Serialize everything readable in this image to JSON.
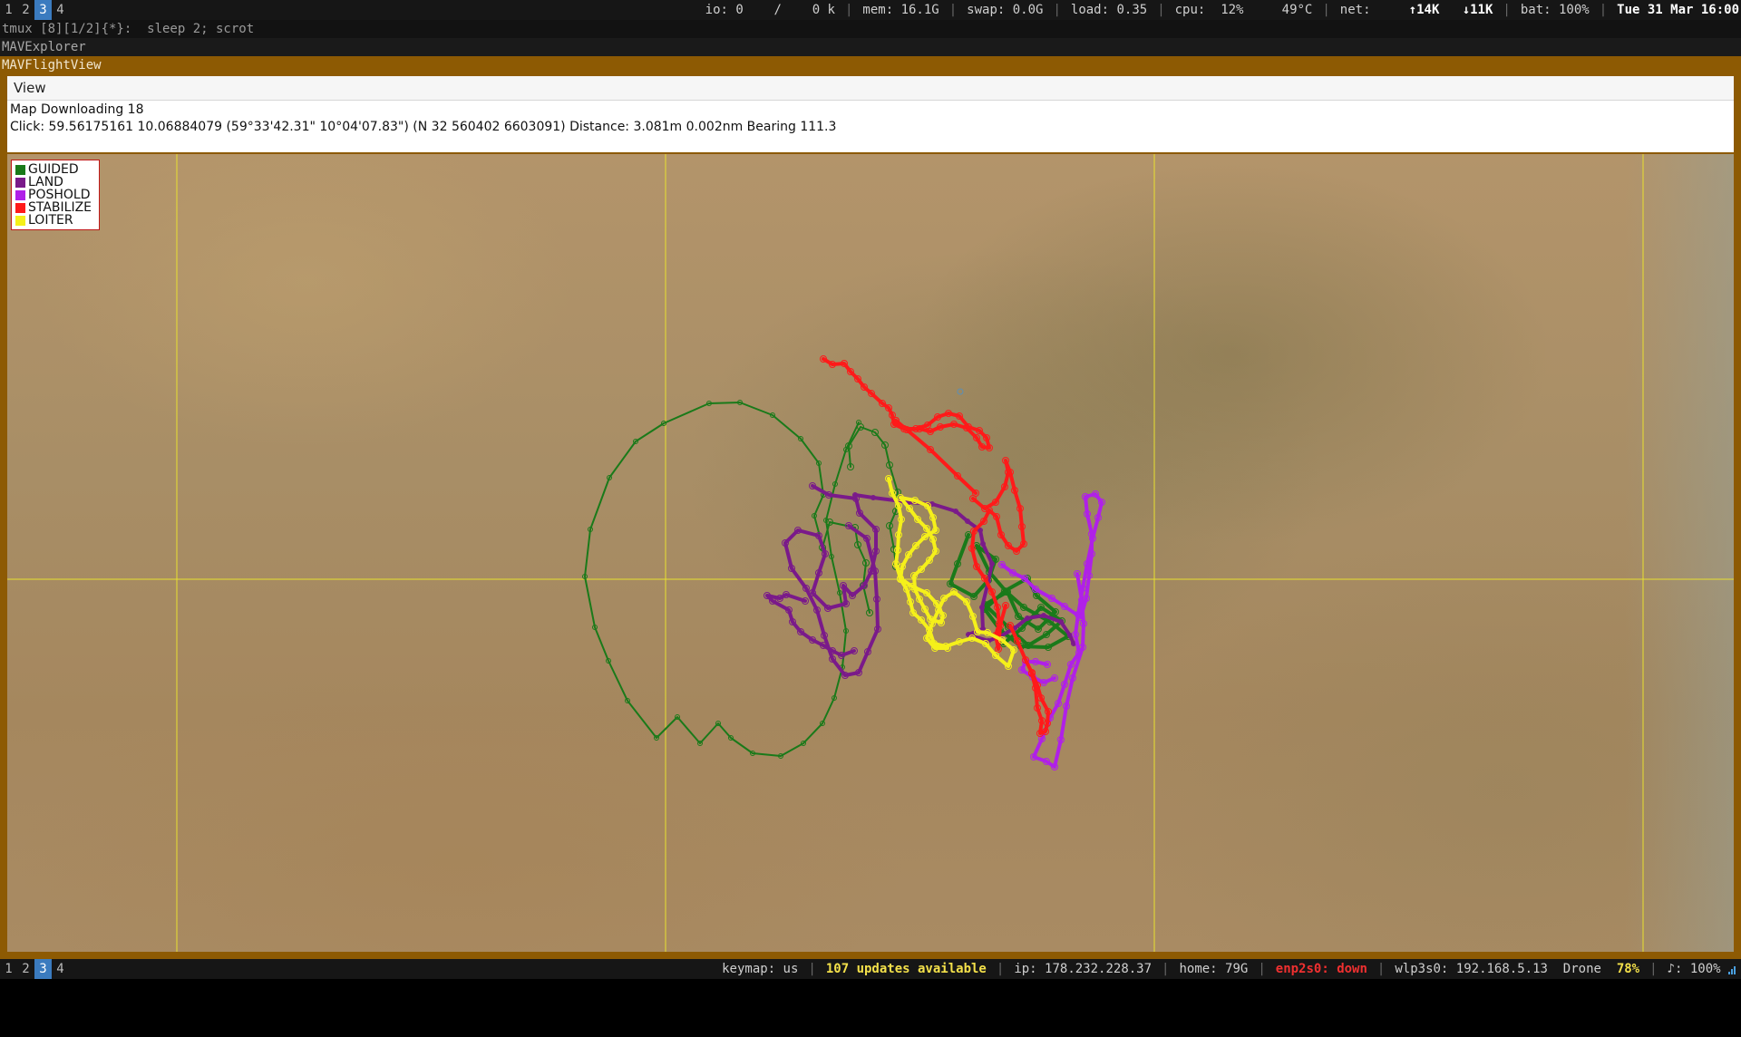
{
  "top_bar": {
    "workspaces": [
      "1",
      "2",
      "3",
      "4"
    ],
    "active_workspace": "3",
    "io_label": "io:",
    "io_value": "0",
    "io_sep": "/",
    "io_value2": "0 k",
    "mem": "mem: 16.1G",
    "swap": "swap: 0.0G",
    "load": "load: 0.35",
    "cpu": "cpu:  12%",
    "temp": "49°C",
    "net_label": "net:",
    "net_up": "↑14K",
    "net_down": "↓11K",
    "bat": "bat: 100%",
    "datetime": "Tue 31 Mar 16:00"
  },
  "tmux_line": "tmux [8][1/2]{*}:  sleep 2; scrot",
  "window_titles": {
    "explorer": "MAVExplorer",
    "flightview": "MAVFlightView"
  },
  "menu": {
    "view": "View"
  },
  "info": {
    "line1": "Map Downloading 18",
    "line2": "Click: 59.56175161 10.06884079 (59°33'42.31\" 10°04'07.83\") (N 32 560402 6603091)  Distance: 3.081m 0.002nm Bearing 111.3"
  },
  "legend": [
    {
      "label": "GUIDED",
      "color": "#1a7a1a"
    },
    {
      "label": "LAND",
      "color": "#7a1a8a"
    },
    {
      "label": "POSHOLD",
      "color": "#b020e8"
    },
    {
      "label": "STABILIZE",
      "color": "#ff1a1a"
    },
    {
      "label": "LOITER",
      "color": "#f5f01a"
    }
  ],
  "grid": {
    "color": "#e8e030"
  },
  "bottom_bar": {
    "workspaces": [
      "1",
      "2",
      "3",
      "4"
    ],
    "active_workspace": "3",
    "keymap": "keymap: us",
    "updates": "107 updates available",
    "ip": "ip: 178.232.228.37",
    "home": "home: 79G",
    "enp": "enp2s0: down",
    "wlp": "wlp3s0: 192.168.5.13",
    "ssid": "Drone",
    "wifi_pct": "78%",
    "volume": "♪: 100%"
  }
}
